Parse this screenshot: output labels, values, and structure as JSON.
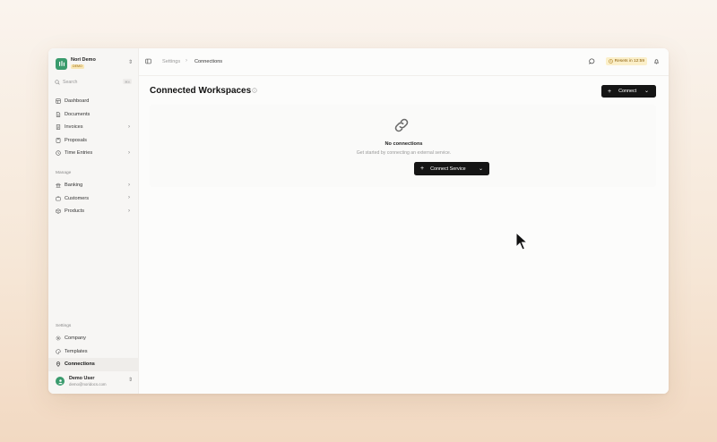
{
  "org": {
    "name": "Nori Demo",
    "badge": "DEMO"
  },
  "search": {
    "placeholder": "Search",
    "shortcut": "⌘K"
  },
  "sidebar": {
    "items": [
      {
        "label": "Dashboard"
      },
      {
        "label": "Documents"
      },
      {
        "label": "Invoices"
      },
      {
        "label": "Proposals"
      },
      {
        "label": "Time Entries"
      }
    ],
    "manage_label": "Manage",
    "manage_items": [
      {
        "label": "Banking"
      },
      {
        "label": "Customers"
      },
      {
        "label": "Products"
      }
    ],
    "settings_label": "Settings",
    "settings_items": [
      {
        "label": "Company"
      },
      {
        "label": "Templates"
      },
      {
        "label": "Connections"
      }
    ]
  },
  "user": {
    "name": "Demo User",
    "email": "demo@noridocs.com"
  },
  "breadcrumb": {
    "parent": "Settings",
    "current": "Connections"
  },
  "topbar": {
    "resets": "Resets in 12:59"
  },
  "page": {
    "title": "Connected Workspaces",
    "connect_label": "Connect",
    "empty_title": "No connections",
    "empty_subtitle": "Get started by connecting an external service.",
    "connect_service_label": "Connect Service"
  },
  "colors": {
    "accent": "#3a9b6d",
    "button": "#151515",
    "badge_bg": "#fbefc9"
  }
}
